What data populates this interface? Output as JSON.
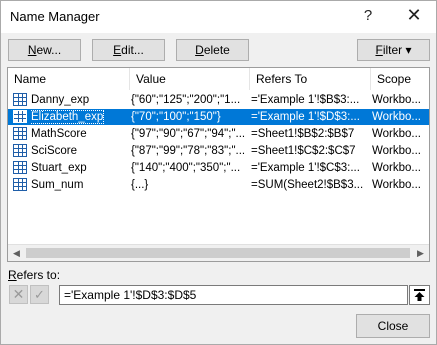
{
  "window": {
    "title": "Name Manager",
    "help_glyph": "?",
    "close_glyph": "✕"
  },
  "toolbar": {
    "new_prefix": "",
    "new_key": "N",
    "new_suffix": "ew...",
    "edit_prefix": "",
    "edit_key": "E",
    "edit_suffix": "dit...",
    "delete_prefix": "",
    "delete_key": "D",
    "delete_suffix": "elete",
    "filter_prefix": "",
    "filter_key": "F",
    "filter_suffix": "ilter",
    "filter_arrow": "▾"
  },
  "list": {
    "columns": [
      "Name",
      "Value",
      "Refers To",
      "Scope"
    ],
    "rows": [
      {
        "name": "Danny_exp",
        "value": "{\"60\";\"125\";\"200\";\"1...",
        "refers_to": "='Example 1'!$B$3:...",
        "scope": "Workbo...",
        "selected": false
      },
      {
        "name": "Elizabeth_exp",
        "value": "{\"70\";\"100\";\"150\"}",
        "refers_to": "='Example 1'!$D$3:...",
        "scope": "Workbo...",
        "selected": true
      },
      {
        "name": "MathScore",
        "value": "{\"97\";\"90\";\"67\";\"94\";\"...",
        "refers_to": "=Sheet1!$B$2:$B$7",
        "scope": "Workbo...",
        "selected": false
      },
      {
        "name": "SciScore",
        "value": "{\"87\";\"99\";\"78\";\"83\";\"...",
        "refers_to": "=Sheet1!$C$2:$C$7",
        "scope": "Workbo...",
        "selected": false
      },
      {
        "name": "Stuart_exp",
        "value": "{\"140\";\"400\";\"350\";\"...",
        "refers_to": "='Example 1'!$C$3:...",
        "scope": "Workbo...",
        "selected": false
      },
      {
        "name": "Sum_num",
        "value": "{...}",
        "refers_to": "=SUM(Sheet2!$B$3...",
        "scope": "Workbo...",
        "selected": false
      }
    ]
  },
  "scrollbar": {
    "left_glyph": "◀",
    "right_glyph": "▶"
  },
  "refers": {
    "label_key": "R",
    "label_suffix": "efers to:",
    "cancel_glyph": "✕",
    "ok_glyph": "✓",
    "value": "='Example 1'!$D$3:$D$5"
  },
  "footer": {
    "close_label": "Close"
  },
  "colors": {
    "selection": "#0078d7",
    "icon": "#1f5ea8"
  }
}
